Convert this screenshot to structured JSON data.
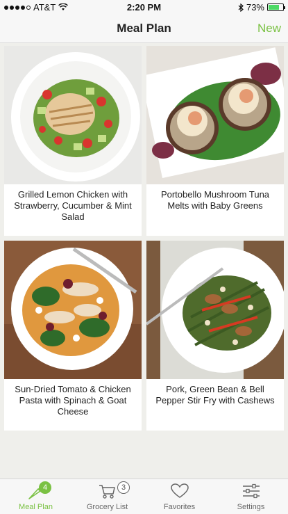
{
  "status_bar": {
    "carrier": "AT&T",
    "time": "2:20 PM",
    "battery": "73%",
    "battery_level": 0.73
  },
  "nav": {
    "title": "Meal Plan",
    "new_label": "New"
  },
  "recipes": [
    {
      "title": "Grilled Lemon Chicken with Strawberry, Cucumber & Mint Salad"
    },
    {
      "title": "Portobello Mushroom Tuna Melts with Baby Greens"
    },
    {
      "title": "Sun-Dried Tomato & Chicken Pasta with Spinach & Goat Cheese"
    },
    {
      "title": "Pork, Green Bean & Bell Pepper Stir Fry with Cashews"
    }
  ],
  "tabs": [
    {
      "label": "Meal Plan",
      "badge": "4",
      "icon": "carrot-icon"
    },
    {
      "label": "Grocery List",
      "badge": "3",
      "icon": "cart-icon"
    },
    {
      "label": "Favorites",
      "icon": "heart-icon"
    },
    {
      "label": "Settings",
      "icon": "sliders-icon"
    }
  ],
  "colors": {
    "accent": "#7ac143",
    "background": "#efefeb"
  }
}
